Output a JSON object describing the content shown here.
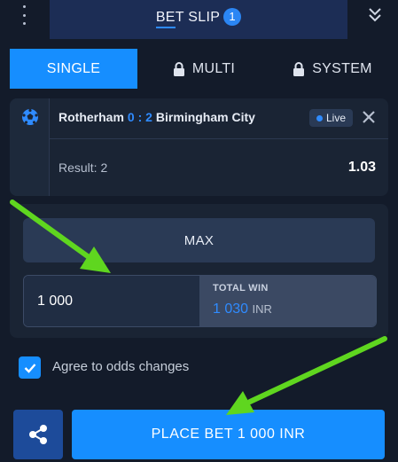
{
  "header": {
    "title": "BET SLIP",
    "count": "1",
    "menu_icon": "vertical-dots-icon",
    "collapse_icon": "double-chevron-down-icon"
  },
  "tabs": [
    {
      "label": "SINGLE",
      "active": true
    },
    {
      "label": "MULTI",
      "icon": "lock-icon"
    },
    {
      "label": "SYSTEM",
      "icon": "lock-icon"
    }
  ],
  "bet": {
    "sport_icon": "football-icon",
    "home": "Rotherham",
    "score": "0 : 2",
    "away": "Birmingham City",
    "live_label": "Live",
    "result_label": "Result: 2",
    "odds": "1.03"
  },
  "stake": {
    "max_label": "MAX",
    "value": "1 000",
    "total_win_label": "TOTAL WIN",
    "total_win_value": "1 030",
    "currency": "INR"
  },
  "agree": {
    "label": "Agree to odds changes",
    "checked": true
  },
  "actions": {
    "share_icon": "share-icon",
    "place_bet_label": "PLACE BET 1 000 INR"
  },
  "colors": {
    "background": "#131b2a",
    "accent": "#168eff",
    "panel": "#1a2434",
    "arrow": "#5fd61f"
  }
}
